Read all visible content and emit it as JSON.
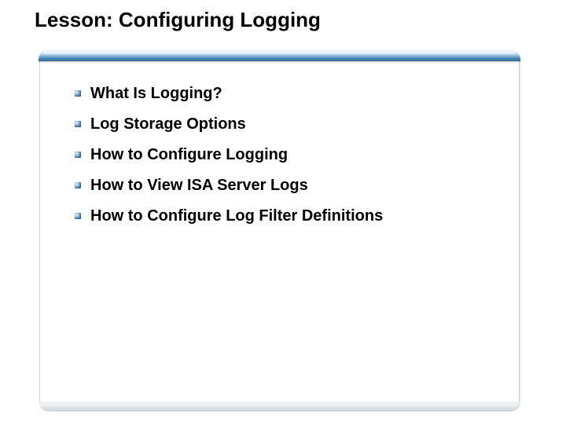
{
  "title": "Lesson: Configuring Logging",
  "items": [
    {
      "label": "What Is Logging?"
    },
    {
      "label": "Log Storage Options"
    },
    {
      "label": "How to Configure Logging"
    },
    {
      "label": "How to View ISA Server Logs"
    },
    {
      "label": "How to Configure Log Filter Definitions"
    }
  ]
}
